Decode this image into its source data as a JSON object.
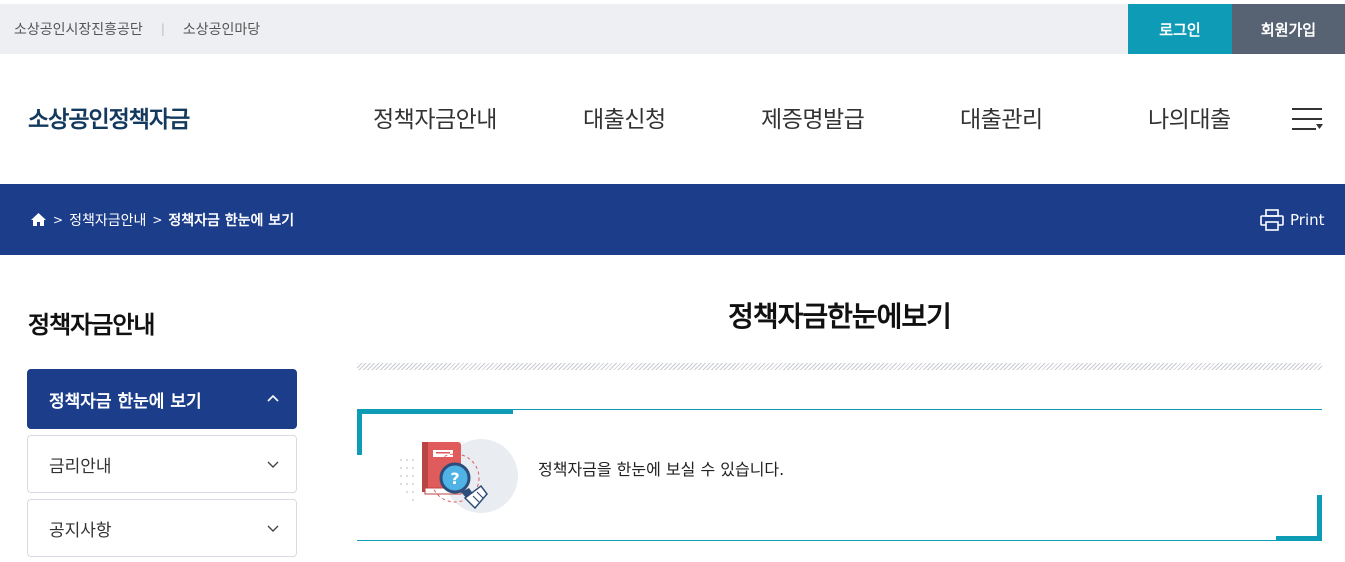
{
  "topbar": {
    "links": [
      "소상공인시장진흥공단",
      "소상공인마당"
    ],
    "separator": "|",
    "login_label": "로그인",
    "join_label": "회원가입"
  },
  "header": {
    "logo": "소상공인정책자금",
    "nav": [
      "정책자금안내",
      "대출신청",
      "제증명발급",
      "대출관리",
      "나의대출"
    ],
    "menu_icon": "hamburger-menu-icon"
  },
  "breadcrumb": {
    "home_icon": "home-icon",
    "items": [
      "정책자금안내",
      "정책자금 한눈에 보기"
    ],
    "print_label": "Print"
  },
  "sidebar": {
    "title": "정책자금안내",
    "items": [
      {
        "label": "정책자금 한눈에 보기",
        "active": true
      },
      {
        "label": "금리안내",
        "active": false
      },
      {
        "label": "공지사항",
        "active": false
      }
    ]
  },
  "main": {
    "title": "정책자금한눈에보기",
    "description": "정책자금을 한눈에 보실 수 있습니다."
  },
  "colors": {
    "primary_navy": "#1b3d8a",
    "accent_teal": "#0e9bb5",
    "join_gray": "#576273"
  }
}
